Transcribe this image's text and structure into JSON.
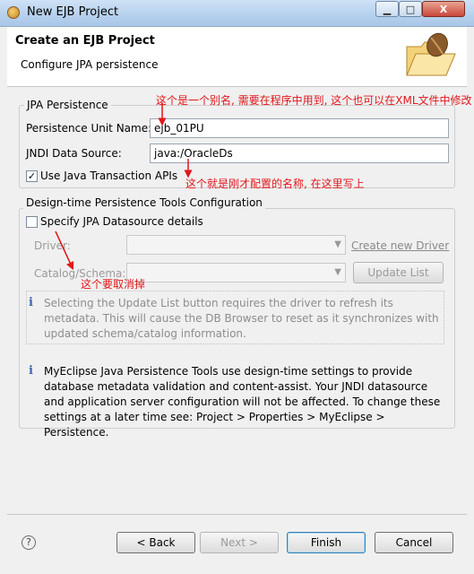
{
  "window": {
    "title": "New EJB Project",
    "close_label": "X"
  },
  "header": {
    "title": "Create an EJB Project",
    "subtitle": "Configure JPA persistence"
  },
  "jpa": {
    "legend": "JPA Persistence",
    "unit_label": "Persistence Unit Name:",
    "unit_value": "ejb_01PU",
    "jndi_label": "JNDI Data Source:",
    "jndi_value": "java:/OracleDs",
    "jta_label": "Use Java Transaction APIs",
    "jta_checked": true
  },
  "design": {
    "legend": "Design-time Persistence Tools Configuration",
    "specify_label": "Specify JPA Datasource details",
    "specify_checked": false,
    "driver_label": "Driver:",
    "create_driver": "Create new Driver",
    "catalog_label": "Catalog/Schema:",
    "update_list": "Update List",
    "info1": "Selecting the Update List button requires the driver to refresh its metadata. This will cause the DB Browser to reset as it synchronizes with updated schema/catalog information.",
    "info2": "MyEclipse Java Persistence Tools use design-time settings to provide database metadata validation and content-assist. Your JNDI datasource and application server configuration will not be affected. To change these settings at a later time see: Project > Properties > MyEclipse > Persistence."
  },
  "annotations": {
    "a1": "这个是一个别名, 需要在程序中用到, 这个也可以在XML文件中修改",
    "a2": "这个就是刚才配置的名称, 在这里写上",
    "a3": "这个要取消掉"
  },
  "footer": {
    "back": "< Back",
    "next": "Next >",
    "finish": "Finish",
    "cancel": "Cancel",
    "help_icon": "?"
  },
  "colors": {
    "annotation": "#e2171c",
    "info_icon": "#3a66b3"
  }
}
